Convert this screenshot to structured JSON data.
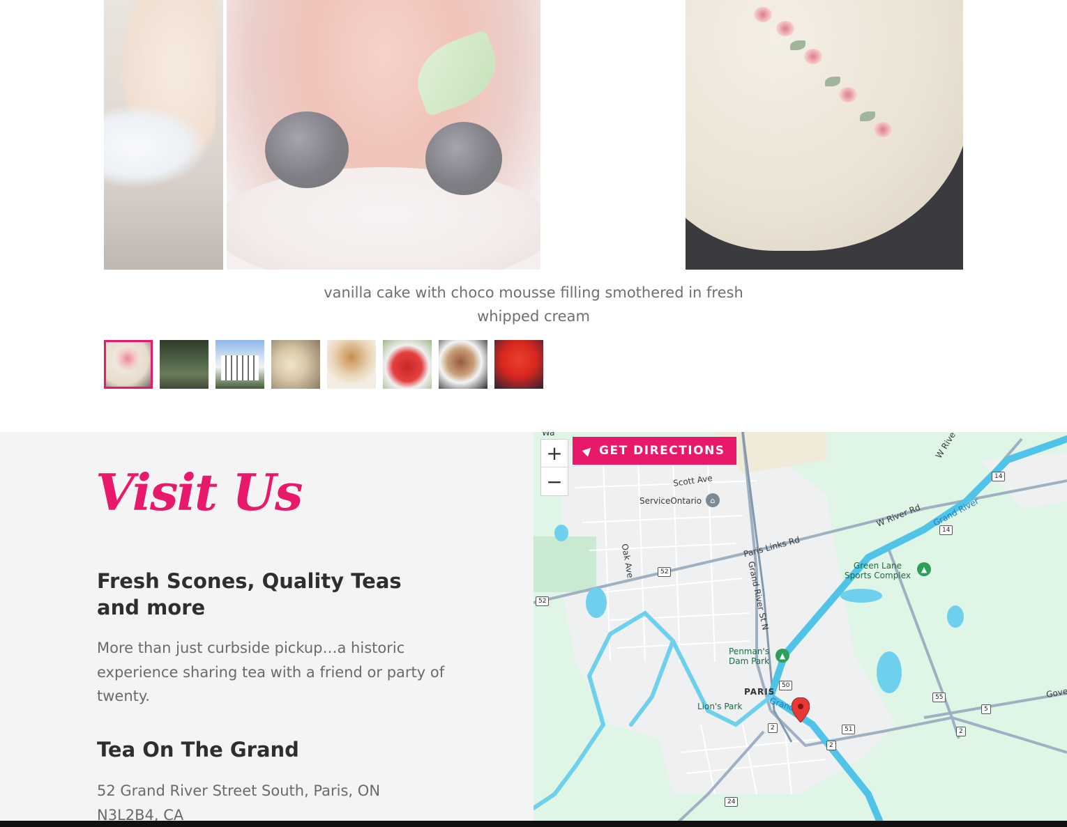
{
  "gallery": {
    "caption": "vanilla cake with choco mousse filling smothered in fresh whipped cream",
    "active_thumbnail_index": 0,
    "thumbnails": [
      {
        "name": "thumb-whipped-cream-cake"
      },
      {
        "name": "thumb-garden-deer"
      },
      {
        "name": "thumb-historic-house"
      },
      {
        "name": "thumb-tea-table"
      },
      {
        "name": "thumb-pie-cookies"
      },
      {
        "name": "thumb-tomato-salad"
      },
      {
        "name": "thumb-scone-basket"
      },
      {
        "name": "thumb-jelly-dessert"
      }
    ]
  },
  "visit": {
    "title": "Visit Us",
    "subtitle": "Fresh Scones, Quality Teas and more",
    "body": "More than just curbside pickup…a historic experience sharing tea with a friend or party of twenty.",
    "business_name": "Tea On The Grand",
    "address": "52 Grand River Street South, Paris, ON N3L2B4, CA"
  },
  "map": {
    "directions_label": "GET DIRECTIONS",
    "zoom_in": "+",
    "zoom_out": "−",
    "labels": {
      "scott_ave": "Scott Ave",
      "service_ontario": "ServiceOntario",
      "oak_ave": "Oak Ave",
      "paris_links_rd": "Paris Links Rd",
      "grand_river_st_n": "Grand River St N",
      "w_river_rd": "W River Rd",
      "grand_river_ne": "Grand River",
      "green_lane": "Green Lane\nSports Complex",
      "penmans": "Penman's\nDam Park",
      "paris": "PARIS",
      "lions_park": "Lion's Park",
      "grand_river_town": "Grand",
      "governors": "Gover",
      "w_rive": "W Rive",
      "wa": "Wa"
    },
    "shields": [
      "14",
      "14",
      "52",
      "52",
      "50",
      "55",
      "5",
      "51",
      "2",
      "2",
      "2",
      "24"
    ],
    "accent_color": "#e8186a"
  }
}
